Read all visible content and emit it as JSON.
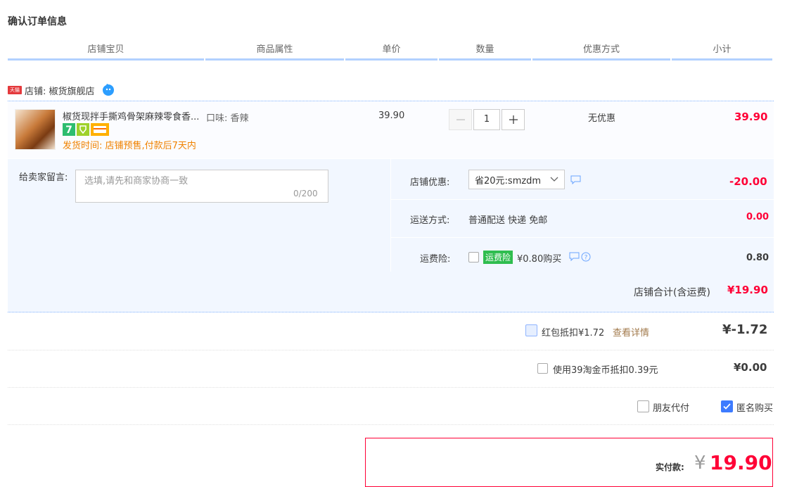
{
  "page": {
    "title": "确认订单信息"
  },
  "columns": [
    "店铺宝贝",
    "商品属性",
    "单价",
    "数量",
    "优惠方式",
    "小计"
  ],
  "shop": {
    "tag": "天猫",
    "label": "店铺: 椒货旗舰店"
  },
  "item": {
    "name": "椒货现拌手撕鸡骨架麻辣零食香...",
    "attribute": "口味: 香辣",
    "price": "39.90",
    "quantity": "1",
    "promo": "无优惠",
    "subtotal": "39.90",
    "ship_time": "发货时间: 店铺预售,付款后7天内",
    "badge_7": "7"
  },
  "message": {
    "label": "给卖家留言:",
    "placeholder": "选填,请先和商家协商一致",
    "count": "0/200"
  },
  "coupon": {
    "label": "店铺优惠:",
    "selected": "省20元:smzdm",
    "amount": "-20.00"
  },
  "delivery": {
    "label": "运送方式:",
    "value": "普通配送 快递 免邮",
    "amount": "0.00"
  },
  "insurance": {
    "label": "运费险:",
    "tag": "运费险",
    "text": "¥0.80购买",
    "amount": "0.80"
  },
  "shop_total": {
    "label": "店铺合计(含运费)",
    "value": "¥19.90"
  },
  "redpacket": {
    "label": "红包抵扣¥1.72",
    "link": "查看详情",
    "value": "¥-1.72"
  },
  "taojinbi": {
    "label": "使用39淘金币抵扣0.39元",
    "value": "¥0.00"
  },
  "friend_pay": {
    "label": "朋友代付"
  },
  "anonymous": {
    "label": "匿名购买",
    "checked": true
  },
  "payment": {
    "label": "实付款:",
    "currency": "¥",
    "value": "19.90"
  },
  "colors": {
    "accent_red": "#ff0036",
    "header_line": "#b2d1ff",
    "panel_bg": "#f2f7ff",
    "ship_orange": "#f08200",
    "checkbox_blue": "#3d7bff"
  }
}
